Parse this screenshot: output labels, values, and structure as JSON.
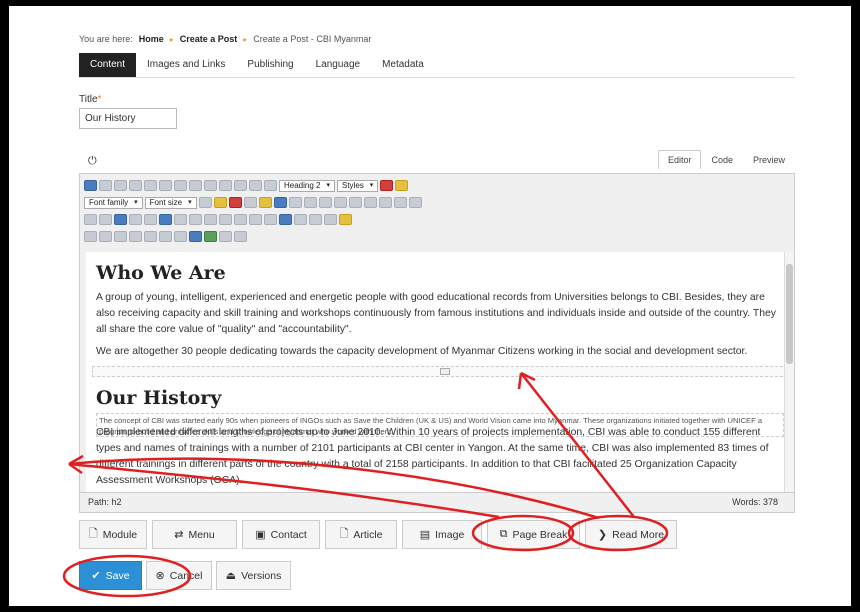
{
  "breadcrumb": {
    "prefix": "You are here:",
    "home": "Home",
    "create": "Create a Post",
    "current": "Create a Post - CBI Myanmar"
  },
  "tabs": [
    "Content",
    "Images and Links",
    "Publishing",
    "Language",
    "Metadata"
  ],
  "title_field": {
    "label": "Title",
    "required_mark": "*",
    "value": "Our History"
  },
  "editor_tabs": [
    "Editor",
    "Code",
    "Preview"
  ],
  "toolbar": {
    "heading_select": "Heading 2",
    "styles_select": "Styles",
    "font_family": "Font family",
    "font_size": "Font size"
  },
  "content": {
    "h1": "Who We Are",
    "p1": "A group of young, intelligent, experienced and energetic people with good educational records from Universities belongs to CBI. Besides, they are also receiving capacity and skill training and workshops continuously from famous institutions and individuals inside and outside of the country. They all share the core value of \"quality\" and \"accountability\".",
    "p2": "We are altogether 30 people dedicating towards the capacity development of Myanmar Citizens working in the social and development sector.",
    "h2": "Our History",
    "note": "The concept of CBI was started early 90s when pioneers of INGOs such as Save the Children (UK & US) and World Vision came into Myanmar. These organizations initiated together with UNICEF a program to build and enhance skills and knowledge of Myanmar who worked with them.",
    "p3": "CBI implemented different lengths of projects up to June 2010. Within 10 years of projects implementation, CBI was able to conduct 155 different types and names of trainings with a number of 2101 participants at CBI center in Yangon. At the same time, CBI was also implemented 83 times of different trainings in different parts of the country with a total of 2158 participants. In addition to that CBI facilitated 25 Organization Capacity Assessment Workshops (OCA)."
  },
  "status": {
    "path": "Path: h2",
    "words": "Words: 378"
  },
  "buttons": [
    "Module",
    "Menu",
    "Contact",
    "Article",
    "Image",
    "Page Break",
    "Read More"
  ],
  "actions": {
    "save": "Save",
    "cancel": "Cancel",
    "versions": "Versions"
  },
  "colors": {
    "active_tab": "#222222",
    "save_button": "#2d8fd6",
    "annotation": "#e02020"
  }
}
